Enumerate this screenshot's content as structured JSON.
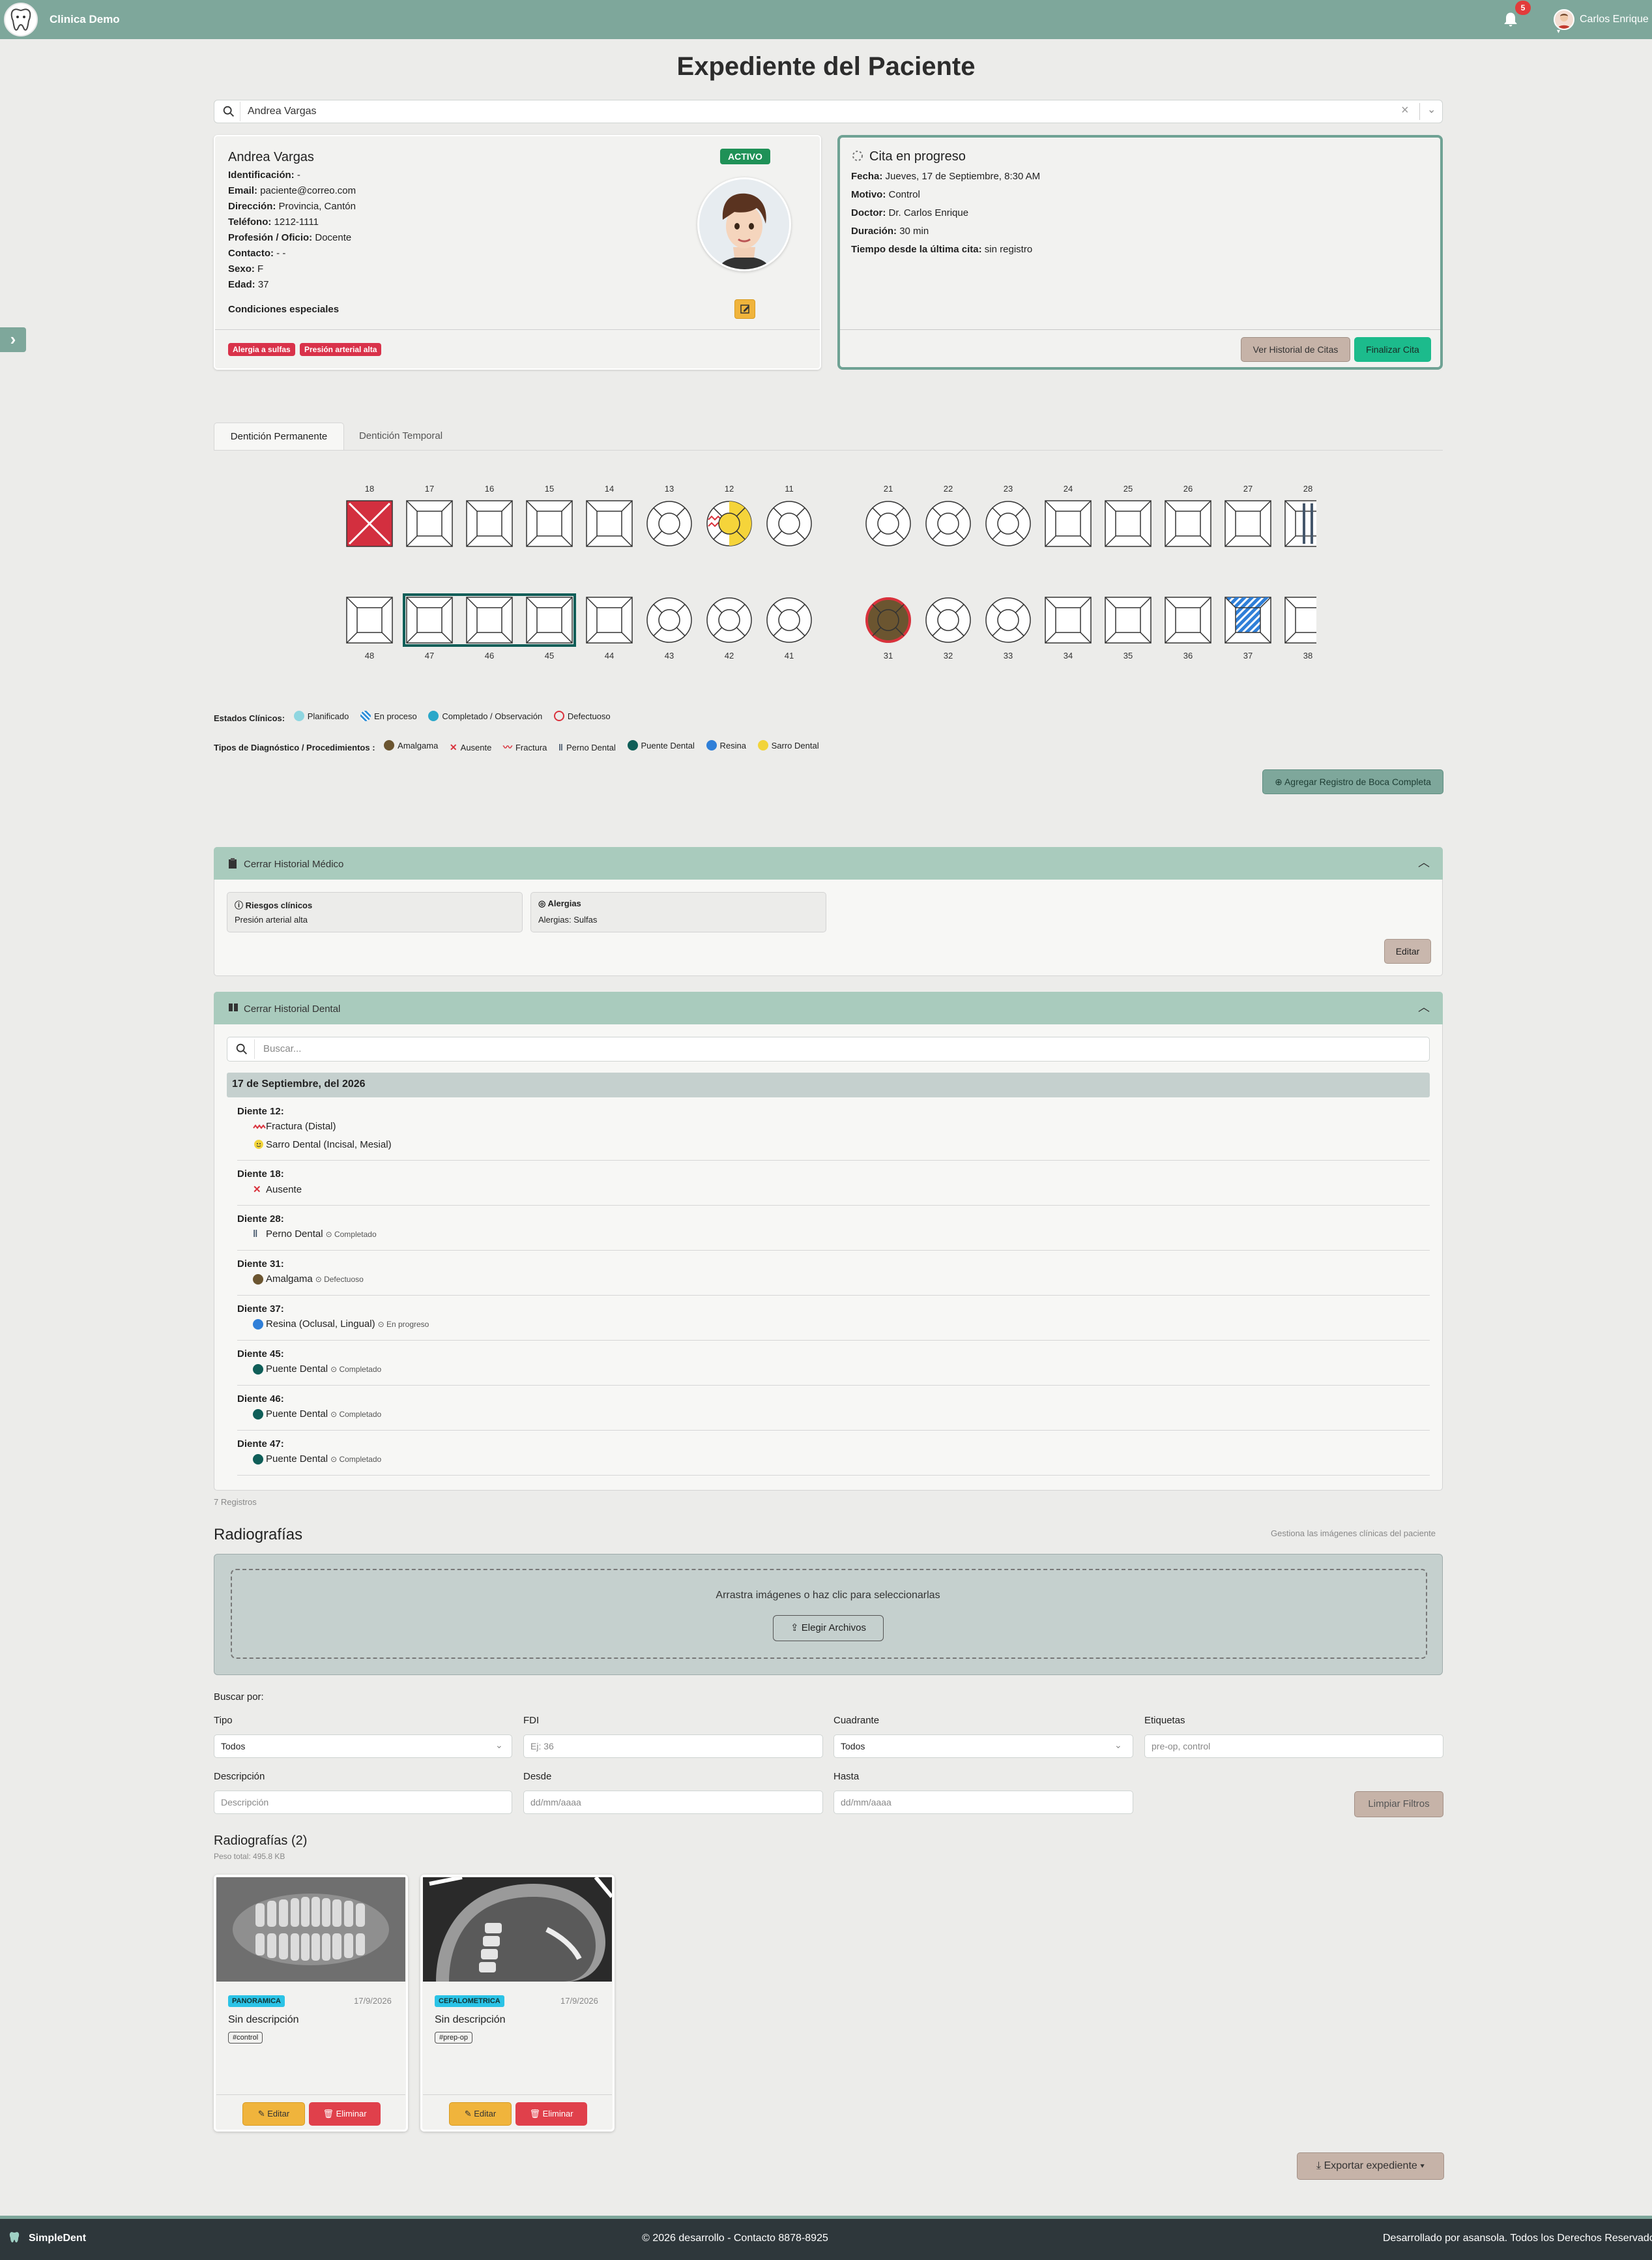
{
  "header": {
    "clinic_name": "Clinica Demo",
    "notification_count": "5",
    "user_name": "Carlos Enrique"
  },
  "page_title": "Expediente del Paciente",
  "patient_search": {
    "value": "Andrea Vargas"
  },
  "patient": {
    "name": "Andrea Vargas",
    "status": "ACTIVO",
    "fields": [
      {
        "label": "Identificación:",
        "value": "-"
      },
      {
        "label": "Email:",
        "value": "paciente@correo.com"
      },
      {
        "label": "Dirección:",
        "value": "Provincia, Cantón"
      },
      {
        "label": "Teléfono:",
        "value": "1212-1111"
      },
      {
        "label": "Profesión / Oficio:",
        "value": "Docente"
      },
      {
        "label": "Contacto:",
        "value": "- -"
      },
      {
        "label": "Sexo:",
        "value": "F"
      },
      {
        "label": "Edad:",
        "value": "37"
      }
    ],
    "special_conditions_label": "Condiciones especiales",
    "tags": [
      "Alergia a sulfas",
      "Presión arterial alta"
    ]
  },
  "appointment": {
    "title": "Cita en progreso",
    "fields": [
      {
        "label": "Fecha:",
        "value": "Jueves, 17 de Septiembre, 8:30 AM"
      },
      {
        "label": "Motivo:",
        "value": "Control"
      },
      {
        "label": "Doctor:",
        "value": "Dr. Carlos Enrique"
      },
      {
        "label": "Duración:",
        "value": "30 min"
      },
      {
        "label": "Tiempo desde la última cita:",
        "value": "sin registro"
      }
    ],
    "history_button": "Ver Historial de Citas",
    "finish_button": "Finalizar Cita"
  },
  "tabs": [
    "Dentición Permanente",
    "Dentición Temporal"
  ],
  "odontogram": {
    "upper": [
      "18",
      "17",
      "16",
      "15",
      "14",
      "13",
      "12",
      "11",
      "21",
      "22",
      "23",
      "24",
      "25",
      "26",
      "27",
      "28"
    ],
    "lower": [
      "48",
      "47",
      "46",
      "45",
      "44",
      "43",
      "42",
      "41",
      "31",
      "32",
      "33",
      "34",
      "35",
      "36",
      "37",
      "38"
    ]
  },
  "legend": {
    "states_label": "Estados Clínicos:",
    "states": [
      {
        "label": "Planificado",
        "color": "#8fd6e0"
      },
      {
        "label": "En proceso",
        "color": "#2f8fd8"
      },
      {
        "label": "Completado / Observación",
        "color": "#2aa7c9"
      },
      {
        "label": "Defectuoso",
        "color": "#d9323c"
      }
    ],
    "types_label": "Tipos de Diagnóstico / Procedimientos :",
    "types": [
      {
        "label": "Amalgama",
        "icon": "amalgam-dot",
        "color": "#6b5530"
      },
      {
        "label": "Ausente",
        "icon": "x-mark",
        "color": "#d9323c"
      },
      {
        "label": "Fractura",
        "icon": "zigzag",
        "color": "#d9323c"
      },
      {
        "label": "Perno Dental",
        "icon": "double-bar",
        "color": "#44566b"
      },
      {
        "label": "Puente Dental",
        "icon": "bridge-dot",
        "color": "#0f5e58"
      },
      {
        "label": "Resina",
        "icon": "resin-dot",
        "color": "#2f7fd8"
      },
      {
        "label": "Sarro Dental",
        "icon": "tartar-face",
        "color": "#f2d43a"
      }
    ]
  },
  "full_mouth_button": "Agregar Registro de Boca Completa",
  "medical_history": {
    "title": "Cerrar Historial Médico",
    "risk_label": "Riesgos clínicos",
    "risk_value": "Presión arterial alta",
    "allergy_label": "Alergias",
    "allergy_value": "Alergias: Sulfas",
    "edit_button": "Editar"
  },
  "dental_history": {
    "title": "Cerrar Historial Dental",
    "search_placeholder": "Buscar...",
    "date": "17 de Septiembre, del 2026",
    "entries": [
      {
        "tooth": "Diente 12:",
        "items": [
          {
            "text": "Fractura (Distal)",
            "icon": "zigzag",
            "status": ""
          },
          {
            "text": "Sarro Dental (Incisal, Mesial)",
            "icon": "tartar-face",
            "status": ""
          }
        ]
      },
      {
        "tooth": "Diente 18:",
        "items": [
          {
            "text": "Ausente",
            "icon": "x-mark",
            "status": ""
          }
        ]
      },
      {
        "tooth": "Diente 28:",
        "items": [
          {
            "text": "Perno Dental",
            "icon": "double-bar",
            "status": "Completado"
          }
        ]
      },
      {
        "tooth": "Diente 31:",
        "items": [
          {
            "text": "Amalgama",
            "icon": "amalgam-dot",
            "status": "Defectuoso"
          }
        ]
      },
      {
        "tooth": "Diente 37:",
        "items": [
          {
            "text": "Resina (Oclusal, Lingual)",
            "icon": "resin-dot",
            "status": "En progreso"
          }
        ]
      },
      {
        "tooth": "Diente 45:",
        "items": [
          {
            "text": "Puente Dental",
            "icon": "bridge-dot",
            "status": "Completado"
          }
        ]
      },
      {
        "tooth": "Diente 46:",
        "items": [
          {
            "text": "Puente Dental",
            "icon": "bridge-dot",
            "status": "Completado"
          }
        ]
      },
      {
        "tooth": "Diente 47:",
        "items": [
          {
            "text": "Puente Dental",
            "icon": "bridge-dot",
            "status": "Completado"
          }
        ]
      }
    ],
    "records_count": "7 Registros"
  },
  "radiographs": {
    "title": "Radiografías",
    "hint": "Gestiona las imágenes clínicas del paciente",
    "drop_text": "Arrastra imágenes o haz clic para seleccionarlas",
    "choose_button": "Elegir Archivos",
    "filter_title": "Buscar por:",
    "filters": {
      "type_label": "Tipo",
      "type_value": "Todos",
      "fdi_label": "FDI",
      "fdi_placeholder": "Ej: 36",
      "quadrant_label": "Cuadrante",
      "quadrant_value": "Todos",
      "tags_label": "Etiquetas",
      "tags_placeholder": "pre-op, control",
      "desc_label": "Descripción",
      "desc_placeholder": "Descripción",
      "from_label": "Desde",
      "from_placeholder": "dd/mm/aaaa",
      "to_label": "Hasta",
      "to_placeholder": "dd/mm/aaaa",
      "clear_button": "Limpiar Filtros"
    },
    "count_title": "Radiografías (2)",
    "total_weight": "Peso total: 495.8 KB",
    "items": [
      {
        "type": "PANORAMICA",
        "date": "17/9/2026",
        "description": "Sin descripción",
        "tag": "#control",
        "edit": "Editar",
        "delete": "Eliminar"
      },
      {
        "type": "CEFALOMETRICA",
        "date": "17/9/2026",
        "description": "Sin descripción",
        "tag": "#prep-op",
        "edit": "Editar",
        "delete": "Eliminar"
      }
    ]
  },
  "export_button": "Exportar expediente",
  "footer": {
    "brand": "SimpleDent",
    "center": "© 2026 desarrollo - Contacto 8878-8925",
    "right": "Desarrollado por asansola. Todos los Derechos Reservados"
  }
}
